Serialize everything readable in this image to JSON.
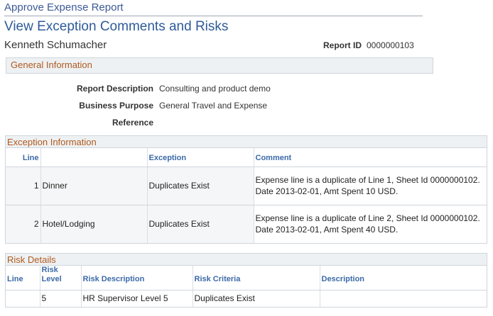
{
  "breadcrumb": "Approve Expense Report",
  "page_title": "View Exception Comments and Risks",
  "employee_name": "Kenneth Schumacher",
  "report_id_label": "Report ID",
  "report_id": "0000000103",
  "general": {
    "title": "General Information",
    "report_description_label": "Report Description",
    "report_description": "Consulting and product demo",
    "business_purpose_label": "Business Purpose",
    "business_purpose": "General Travel and Expense",
    "reference_label": "Reference",
    "reference": ""
  },
  "exceptions": {
    "title": "Exception Information",
    "columns": [
      "Line",
      "",
      "Exception",
      "Comment"
    ],
    "rows": [
      {
        "line": "1",
        "item": "Dinner",
        "exception": "Duplicates Exist",
        "comment": "Expense line is a duplicate of Line 1, Sheet Id 0000000102. Date 2013-02-01, Amt Spent 10 USD."
      },
      {
        "line": "2",
        "item": "Hotel/Lodging",
        "exception": "Duplicates Exist",
        "comment": "Expense line is a duplicate of Line 2, Sheet Id 0000000102. Date 2013-02-01, Amt Spent 40 USD."
      }
    ]
  },
  "risks": {
    "title": "Risk Details",
    "columns": [
      "Line",
      "Risk Level",
      "Risk Description",
      "Risk Criteria",
      "Description"
    ],
    "rows": [
      {
        "line": "",
        "level": "5",
        "description": "HR Supervisor Level 5",
        "criteria": "Duplicates Exist",
        "desc": ""
      }
    ]
  }
}
